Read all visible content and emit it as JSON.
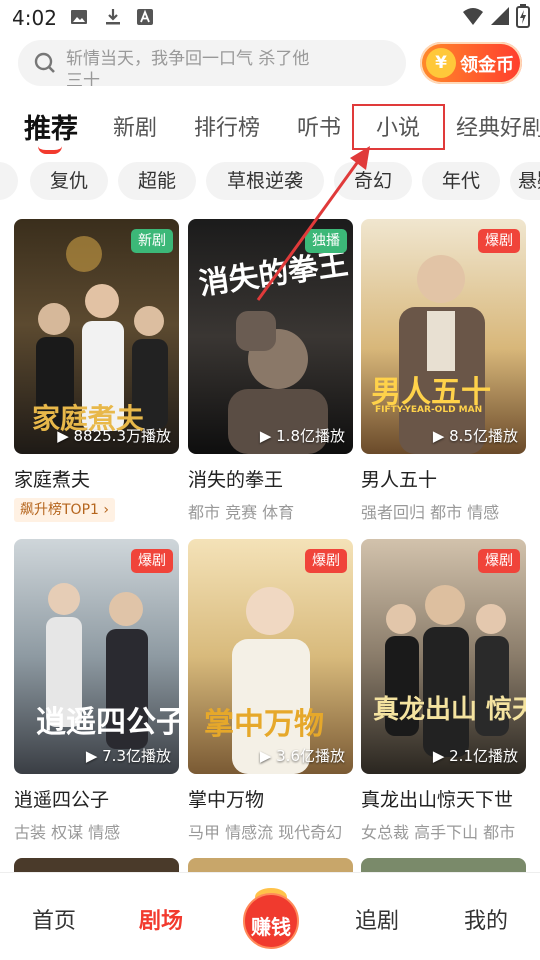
{
  "status_bar": {
    "time": "4:02"
  },
  "search": {
    "placeholder_text": "斩情当天，我争回一口气 杀了他三十",
    "coin_label": "领金币",
    "coin_symbol": "¥"
  },
  "tabs": [
    {
      "label": "推荐",
      "active": true
    },
    {
      "label": "新剧",
      "active": false
    },
    {
      "label": "排行榜",
      "active": false
    },
    {
      "label": "听书",
      "active": false
    },
    {
      "label": "小说",
      "active": false
    },
    {
      "label": "经典好剧",
      "active": false
    }
  ],
  "genres": [
    "复仇",
    "超能",
    "草根逆袭",
    "奇幻",
    "年代",
    "悬疑"
  ],
  "cards": [
    {
      "title": "家庭煮夫",
      "badge": "新剧",
      "plays": "8825.3万播放",
      "poster_title": "家庭煮夫",
      "rank_tag": "飙升榜TOP1 ›",
      "tags": ""
    },
    {
      "title": "消失的拳王",
      "badge": "独播",
      "plays": "1.8亿播放",
      "poster_title": "消失的拳王",
      "rank_tag": "",
      "tags": "都市 竞赛 体育"
    },
    {
      "title": "男人五十",
      "badge": "爆剧",
      "plays": "8.5亿播放",
      "poster_title": "男人五十",
      "poster_subtitle": "FIFTY-YEAR-OLD MAN",
      "rank_tag": "",
      "tags": "强者回归 都市 情感"
    },
    {
      "title": "逍遥四公子",
      "badge": "爆剧",
      "plays": "7.3亿播放",
      "poster_title": "逍遥四公子",
      "rank_tag": "",
      "tags": "古装 权谋 情感"
    },
    {
      "title": "掌中万物",
      "badge": "爆剧",
      "plays": "3.6亿播放",
      "poster_title": "掌中万物",
      "rank_tag": "",
      "tags": "马甲 情感流 现代奇幻"
    },
    {
      "title": "真龙出山惊天下世",
      "badge": "爆剧",
      "plays": "2.1亿播放",
      "poster_title": "真龙出山 惊天下",
      "rank_tag": "",
      "tags": "女总裁 高手下山 都市"
    }
  ],
  "bottom_nav": [
    {
      "label": "首页",
      "active": false
    },
    {
      "label": "剧场",
      "active": true
    },
    {
      "label": "赚钱",
      "active": false
    },
    {
      "label": "追剧",
      "active": false
    },
    {
      "label": "我的",
      "active": false
    }
  ],
  "colors": {
    "accent": "#f23a2e",
    "badge_green": "#3cb878",
    "badge_red": "#f0443a",
    "highlight_box": "#e03a3a"
  }
}
